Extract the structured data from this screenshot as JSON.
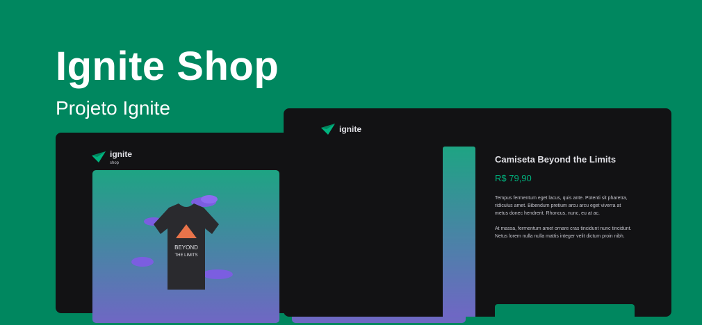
{
  "hero": {
    "title": "Ignite Shop",
    "subtitle": "Projeto Ignite"
  },
  "home": {
    "logo": {
      "name": "ignite",
      "sub": "shop"
    },
    "products": [
      {
        "image": "tshirt-beyond-the-limits"
      },
      {
        "image": "tshirt-astronaut"
      }
    ],
    "nav_icon": "chevron-right-icon"
  },
  "product_page": {
    "logo": {
      "name": "ignite"
    },
    "title": "Camiseta Beyond the Limits",
    "price": "R$ 79,90",
    "description": [
      "Tempus fermentum eget lacus, quis ante. Potenti sit pharetra, ridiculus amet. Bibendum pretium arcu arcu eget viverra at metus donec hendrerit. Rhoncus, nunc, eu at ac.",
      "At massa, fermentum amet ornare cras tincidunt nunc tincidunt. Netus lorem nulla nulla mattis integer velit dictum proin nibh."
    ]
  },
  "colors": {
    "background": "#00875f",
    "window": "#121214",
    "gradient_top": "#1ea483",
    "gradient_bottom": "#6f67c4",
    "price": "#00b37e"
  }
}
